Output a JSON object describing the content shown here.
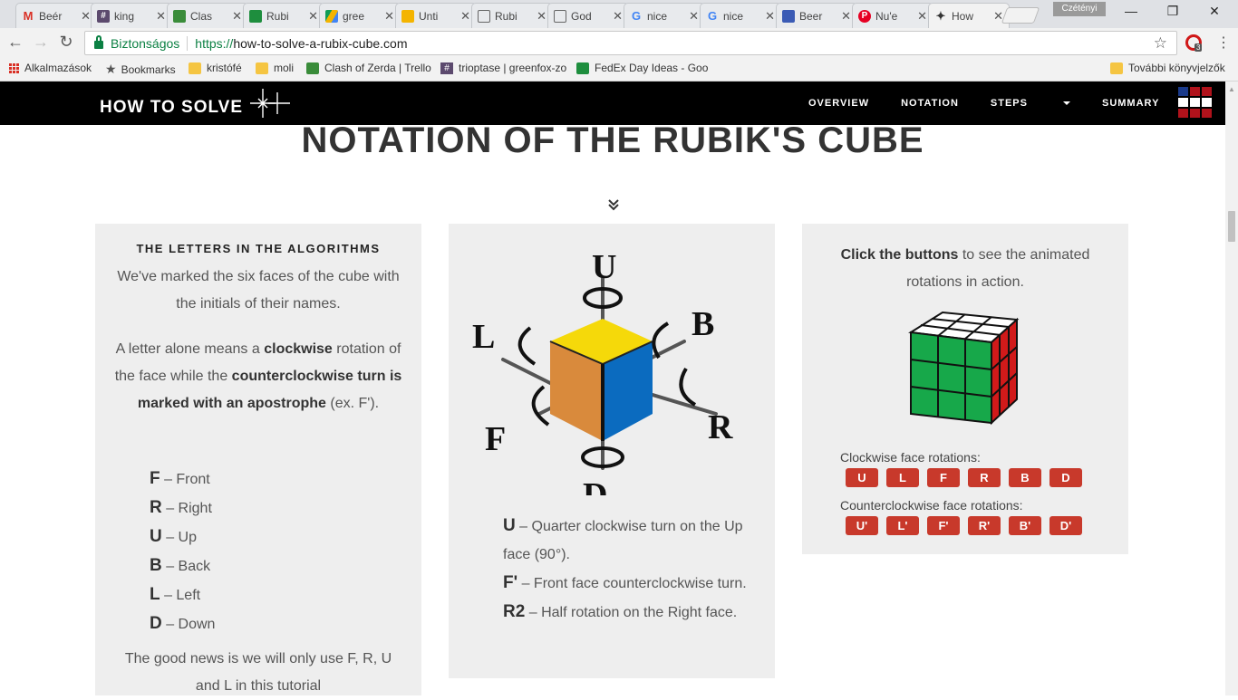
{
  "browser": {
    "tabs": [
      {
        "title": "Beér",
        "favicon": "gmail-icon",
        "badge": "0"
      },
      {
        "title": "king",
        "favicon": "hash-icon"
      },
      {
        "title": "Clas",
        "favicon": "trello-icon"
      },
      {
        "title": "Rubi",
        "favicon": "sheets-icon"
      },
      {
        "title": "gree",
        "favicon": "drive-icon"
      },
      {
        "title": "Unti",
        "favicon": "slides-icon"
      },
      {
        "title": "Rubi",
        "favicon": "doc-icon"
      },
      {
        "title": "God",
        "favicon": "doc-icon"
      },
      {
        "title": "nice",
        "favicon": "google-icon"
      },
      {
        "title": "nice",
        "favicon": "google-icon"
      },
      {
        "title": "Beer",
        "favicon": "image-icon"
      },
      {
        "title": "Nu'e",
        "favicon": "pinterest-icon"
      },
      {
        "title": "How",
        "favicon": "sparkle-icon",
        "active": true
      }
    ],
    "profile_name": "Czétényi",
    "security_label": "Biztonságos",
    "url_scheme": "https://",
    "url_rest": "how-to-solve-a-rubix-cube.com",
    "extension_badge": "3",
    "bookmarks": [
      {
        "label": "Alkalmazások",
        "icon": "apps-icon"
      },
      {
        "label": "Bookmarks",
        "icon": "star-icon"
      },
      {
        "label": "kristófé",
        "icon": "folder-icon"
      },
      {
        "label": "moli",
        "icon": "folder-icon"
      },
      {
        "label": "Clash of Zerda | Trello",
        "icon": "trello-icon"
      },
      {
        "label": "trioptase | greenfox-zo",
        "icon": "hash-icon"
      },
      {
        "label": "FedEx Day Ideas - Goo",
        "icon": "sheets-icon"
      }
    ],
    "other_bookmarks": "További könyvjelzők"
  },
  "site": {
    "logo": "HOW TO SOLVE",
    "nav": {
      "overview": "OVERVIEW",
      "notation": "NOTATION",
      "steps": "STEPS",
      "summary": "SUMMARY"
    },
    "page_title": "NOTATION OF THE RUBIK'S CUBE",
    "card1": {
      "heading": "THE LETTERS IN THE ALGORITHMS",
      "p1": "We've marked the six faces of the cube with the initials of their names.",
      "p2": {
        "t1": "A letter alone means a ",
        "b1": "clockwise",
        "t2": " rotation of the face while the ",
        "b2": "counterclockwise turn is marked with an apostrophe",
        "t3": " (ex. F')."
      },
      "letters": [
        {
          "letter": "F",
          "name": "– Front"
        },
        {
          "letter": "R",
          "name": "– Right"
        },
        {
          "letter": "U",
          "name": "– Up"
        },
        {
          "letter": "B",
          "name": "– Back"
        },
        {
          "letter": "L",
          "name": "– Left"
        },
        {
          "letter": "D",
          "name": "– Down"
        }
      ],
      "p3": "The good news is we will only use F, R, U and L in this tutorial"
    },
    "card2": {
      "diagram_labels": {
        "u": "U",
        "b": "B",
        "l": "L",
        "r": "R",
        "f": "F",
        "d": "D"
      },
      "defs": [
        {
          "code": "U",
          "text": " – Quarter clockwise turn on the Up face (90°)."
        },
        {
          "code": "F'",
          "text": " – Front face counterclockwise turn."
        },
        {
          "code": "R2",
          "text": " – Half rotation on the Right face."
        }
      ]
    },
    "card3": {
      "intro_bold": "Click the buttons",
      "intro_rest": " to see the animated rotations in action.",
      "clockwise_label": "Clockwise face rotations:",
      "clockwise_buttons": [
        "U",
        "L",
        "F",
        "R",
        "B",
        "D"
      ],
      "counter_label": "Counterclockwise face rotations:",
      "counter_buttons": [
        "U'",
        "L'",
        "F'",
        "R'",
        "B'",
        "D'"
      ]
    }
  },
  "colors": {
    "button_red": "#c8392b",
    "nav_bg": "#000000",
    "card_bg": "#eeeeee",
    "cube_top": "#f5d90a",
    "cube_left": "#d98a3c",
    "cube_right": "#0b6bbf",
    "mini_front": "#17a84a",
    "mini_side": "#d11a1a"
  }
}
